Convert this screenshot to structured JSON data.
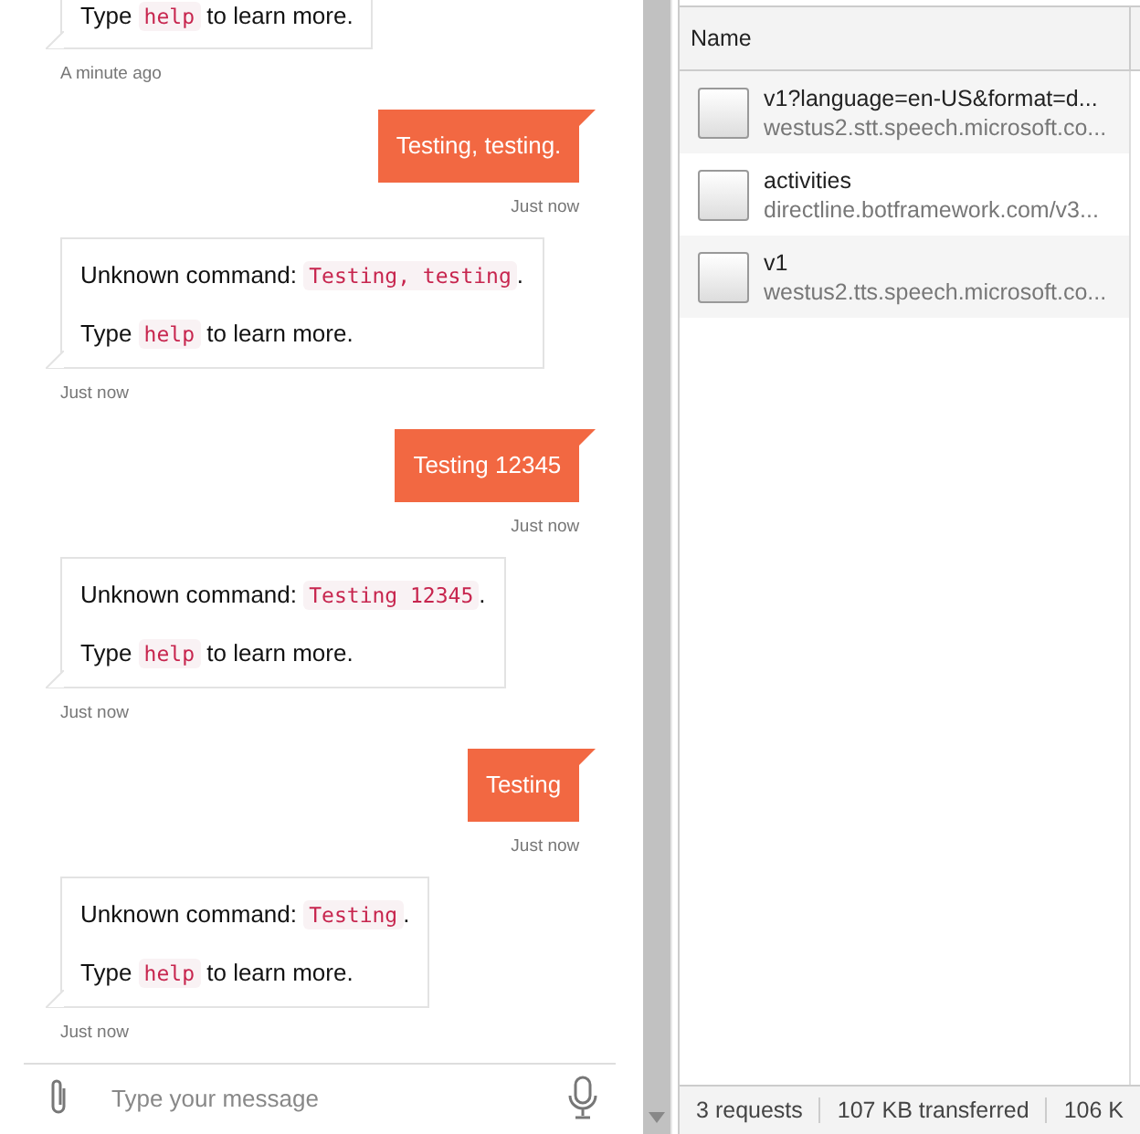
{
  "chat": {
    "messages": [
      {
        "kind": "bot",
        "lines": [
          [
            {
              "kind": "text",
              "text": "Type "
            },
            {
              "kind": "code",
              "text": "help"
            },
            {
              "kind": "text",
              "text": " to learn more."
            }
          ]
        ],
        "time": "A minute ago"
      },
      {
        "kind": "user",
        "text": "Testing, testing.",
        "time": "Just now"
      },
      {
        "kind": "bot",
        "lines": [
          [
            {
              "kind": "text",
              "text": "Unknown command: "
            },
            {
              "kind": "code",
              "text": "Testing, testing"
            },
            {
              "kind": "text",
              "text": "."
            }
          ],
          [
            {
              "kind": "text",
              "text": "Type "
            },
            {
              "kind": "code",
              "text": "help"
            },
            {
              "kind": "text",
              "text": " to learn more."
            }
          ]
        ],
        "time": "Just now"
      },
      {
        "kind": "user",
        "text": "Testing 12345",
        "time": "Just now"
      },
      {
        "kind": "bot",
        "lines": [
          [
            {
              "kind": "text",
              "text": "Unknown command: "
            },
            {
              "kind": "code",
              "text": "Testing 12345"
            },
            {
              "kind": "text",
              "text": "."
            }
          ],
          [
            {
              "kind": "text",
              "text": "Type "
            },
            {
              "kind": "code",
              "text": "help"
            },
            {
              "kind": "text",
              "text": " to learn more."
            }
          ]
        ],
        "time": "Just now"
      },
      {
        "kind": "user",
        "text": "Testing",
        "time": "Just now"
      },
      {
        "kind": "bot",
        "lines": [
          [
            {
              "kind": "text",
              "text": "Unknown command: "
            },
            {
              "kind": "code",
              "text": "Testing"
            },
            {
              "kind": "text",
              "text": "."
            }
          ],
          [
            {
              "kind": "text",
              "text": "Type "
            },
            {
              "kind": "code",
              "text": "help"
            },
            {
              "kind": "text",
              "text": " to learn more."
            }
          ]
        ],
        "time": "Just now"
      }
    ],
    "input": {
      "placeholder": "Type your message"
    }
  },
  "network": {
    "columns": [
      "Name"
    ],
    "requests": [
      {
        "name": "v1?language=en-US&format=d...",
        "host": "westus2.stt.speech.microsoft.co..."
      },
      {
        "name": "activities",
        "host": "directline.botframework.com/v3..."
      },
      {
        "name": "v1",
        "host": "westus2.tts.speech.microsoft.co..."
      }
    ],
    "status_bar": [
      "3 requests",
      "107 KB transferred",
      "106 K"
    ]
  }
}
